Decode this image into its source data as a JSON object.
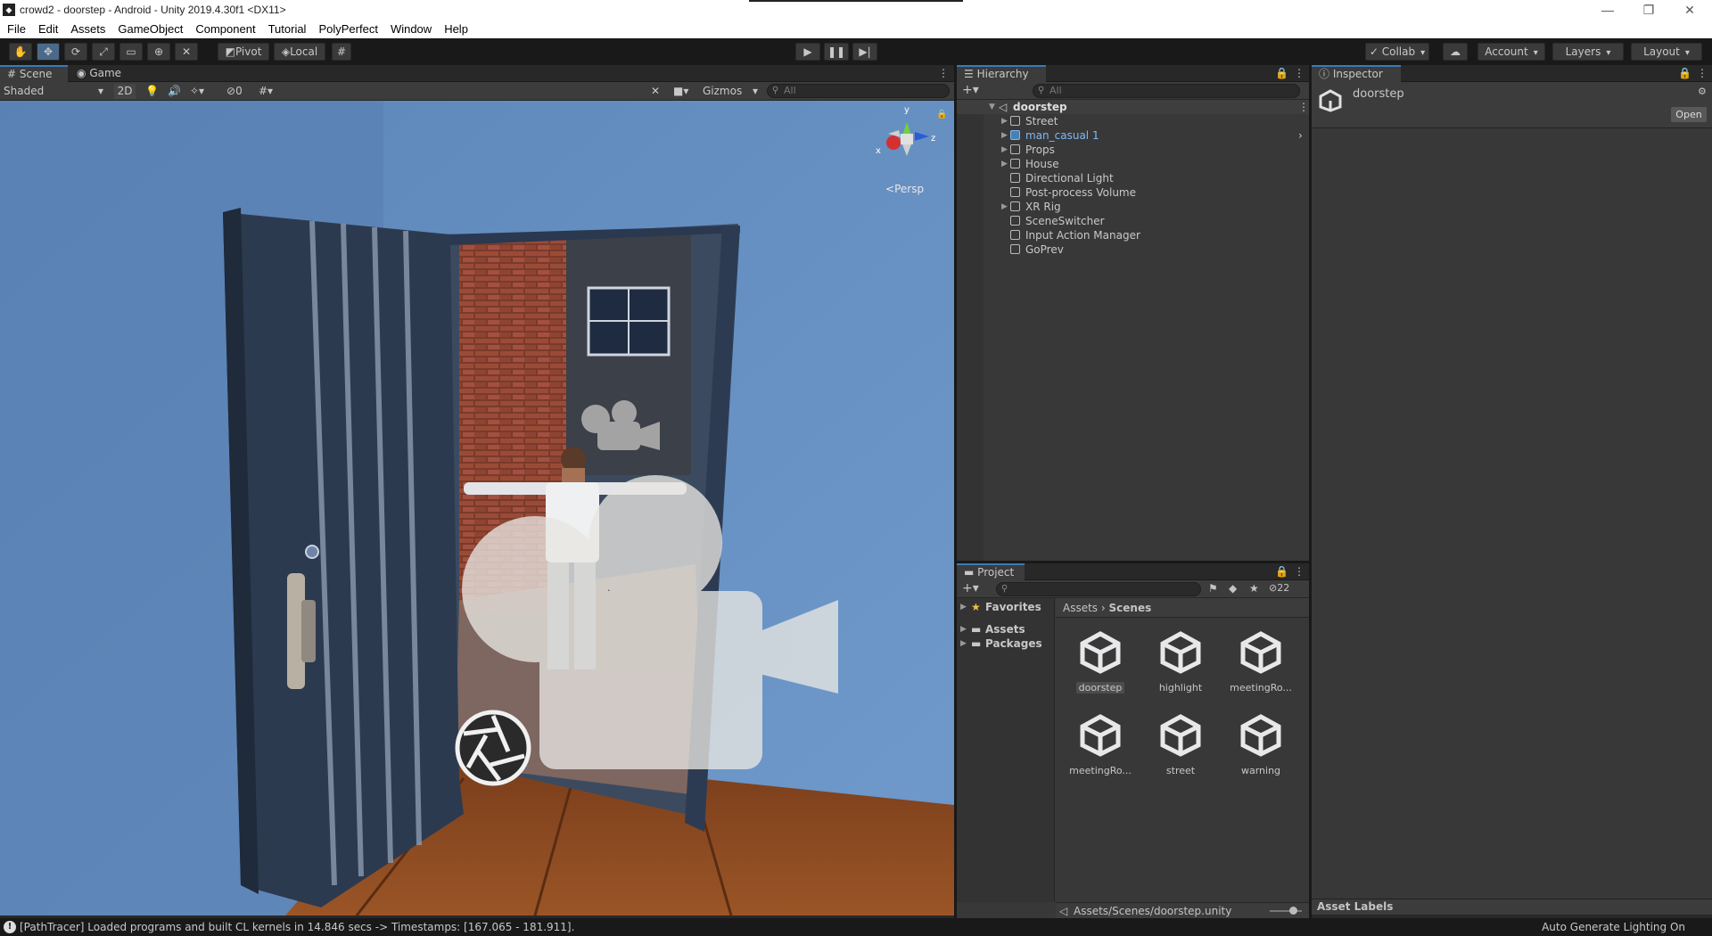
{
  "window": {
    "title": "crowd2 - doorstep - Android - Unity 2019.4.30f1 <DX11>",
    "minimize": "—",
    "maximize": "❐",
    "close": "✕"
  },
  "menu": [
    "File",
    "Edit",
    "Assets",
    "GameObject",
    "Component",
    "Tutorial",
    "PolyPerfect",
    "Window",
    "Help"
  ],
  "toolbar": {
    "pivot": "Pivot",
    "local": "Local",
    "collab": "Collab",
    "account": "Account",
    "layers": "Layers",
    "layout": "Layout"
  },
  "scene_panel": {
    "tabs": [
      "Scene",
      "Game"
    ],
    "draw_mode": "Shaded",
    "mode_2d": "2D",
    "hidden_count": "0",
    "gizmos": "Gizmos",
    "search_placeholder": "All",
    "persp_label": "Persp",
    "axis_x": "x",
    "axis_y": "y",
    "axis_z": "z"
  },
  "hierarchy": {
    "tab": "Hierarchy",
    "search_placeholder": "All",
    "scene": "doorstep",
    "items": [
      {
        "label": "Street",
        "expandable": true,
        "prefab": false
      },
      {
        "label": "man_casual 1",
        "expandable": true,
        "prefab": true
      },
      {
        "label": "Props",
        "expandable": true,
        "prefab": false
      },
      {
        "label": "House",
        "expandable": true,
        "prefab": false
      },
      {
        "label": "Directional Light",
        "expandable": false,
        "prefab": false
      },
      {
        "label": "Post-process Volume",
        "expandable": false,
        "prefab": false
      },
      {
        "label": "XR Rig",
        "expandable": true,
        "prefab": false
      },
      {
        "label": "SceneSwitcher",
        "expandable": false,
        "prefab": false
      },
      {
        "label": "Input Action Manager",
        "expandable": false,
        "prefab": false
      },
      {
        "label": "GoPrev",
        "expandable": false,
        "prefab": false
      }
    ]
  },
  "inspector": {
    "tab": "Inspector",
    "asset_name": "doorstep",
    "open_button": "Open",
    "asset_labels": "Asset Labels"
  },
  "project": {
    "tab": "Project",
    "hidden_count": "22",
    "favorites": "Favorites",
    "tree": [
      "Assets",
      "Packages"
    ],
    "breadcrumb": [
      "Assets",
      "Scenes"
    ],
    "assets": [
      "doorstep",
      "highlight",
      "meetingRo...",
      "meetingRo...",
      "street",
      "warning"
    ],
    "selected_asset": "doorstep",
    "path": "Assets/Scenes/doorstep.unity"
  },
  "status": {
    "message": "[PathTracer] Loaded programs and built CL kernels in 14.846 secs -> Timestamps: [167.065 - 181.911].",
    "right": "Auto Generate Lighting On"
  },
  "colors": {
    "accent": "#3a79bb",
    "prefab_text": "#7cb9f5",
    "panel_bg": "#383838"
  }
}
